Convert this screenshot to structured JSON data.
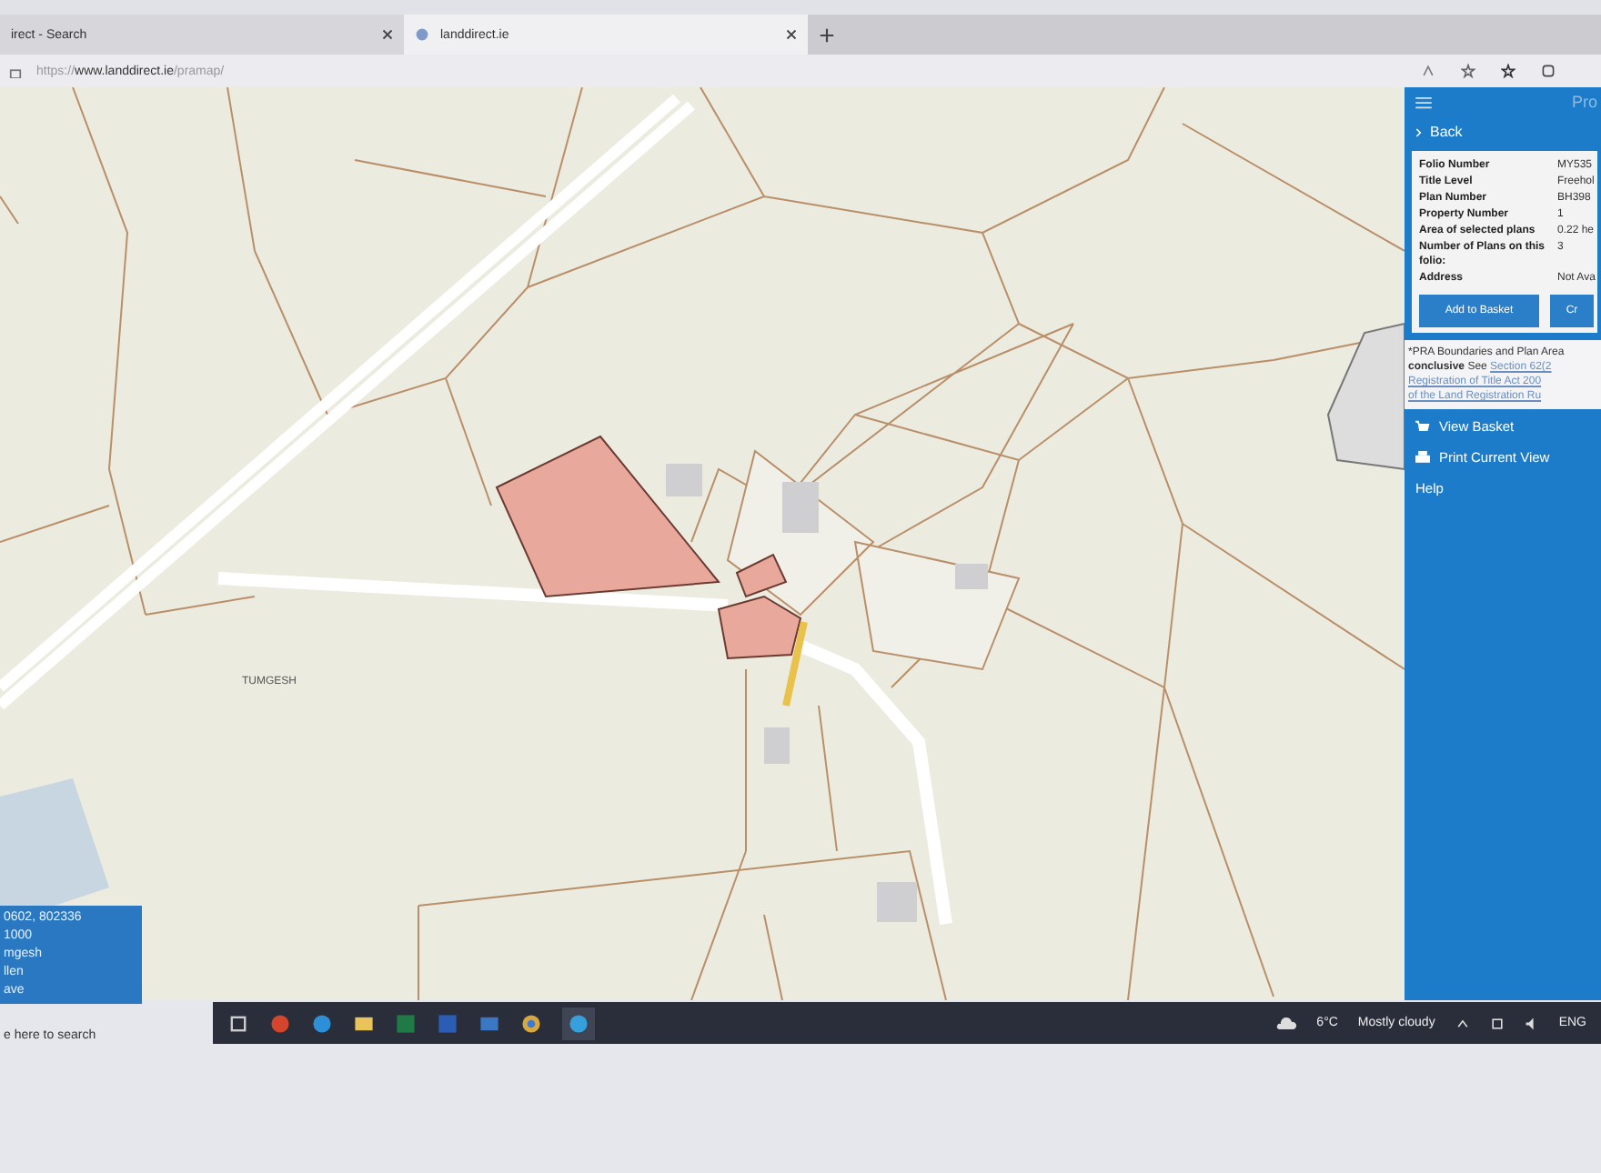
{
  "browser": {
    "tabs": [
      {
        "label": "irect - Search",
        "selected": false
      },
      {
        "label": "landdirect.ie",
        "selected": true
      }
    ],
    "url": {
      "prefix": "https://",
      "host": "www.landdirect.ie",
      "path": "/pramap/"
    }
  },
  "map": {
    "place_label": "TUMGESH",
    "info_box": [
      "0602, 802336",
      "1000",
      "mgesh",
      "llen",
      "ave"
    ]
  },
  "panel": {
    "title": "Pro",
    "back": "Back",
    "rows": [
      {
        "label": "Folio Number",
        "value": "MY535"
      },
      {
        "label": "Title Level",
        "value": "Freehol"
      },
      {
        "label": "Plan Number",
        "value": "BH398"
      },
      {
        "label": "Property Number",
        "value": "1"
      },
      {
        "label": "Area of selected plans",
        "value": "0.22 he"
      },
      {
        "label": "Number of Plans on this folio:",
        "value": "3"
      },
      {
        "label": "Address",
        "value": "Not Ava"
      }
    ],
    "buttons": [
      "Add to Basket",
      "Cr"
    ],
    "notice": {
      "line_1": "*PRA Boundaries and Plan Area",
      "bold": "conclusive",
      "see": "See",
      "links": [
        "Section 62(2",
        "Registration of Title Act 200",
        "of the Land Registration Ru"
      ]
    },
    "links": [
      {
        "kind": "basket",
        "label": "View Basket"
      },
      {
        "kind": "print",
        "label": "Print Current View"
      },
      {
        "kind": "plain",
        "label": "Help"
      }
    ]
  },
  "taskbar": {
    "search": {
      "placeholder": "e here to search"
    },
    "temperature": "6°C",
    "weather": "Mostly cloudy",
    "language": "ENG"
  }
}
